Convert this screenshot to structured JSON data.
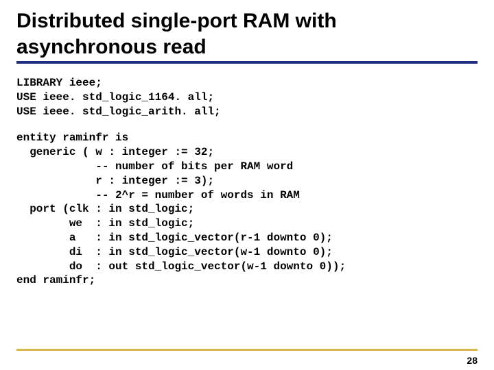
{
  "slide": {
    "title": "Distributed single-port RAM with asynchronous read",
    "page_number": "28"
  },
  "code": {
    "library_section": "LIBRARY ieee;\nUSE ieee. std_logic_1164. all;\nUSE ieee. std_logic_arith. all;",
    "entity_section": "entity raminfr is\n  generic ( w : integer := 32;\n            -- number of bits per RAM word\n            r : integer := 3);\n            -- 2^r = number of words in RAM\n  port (clk : in std_logic;\n        we  : in std_logic;\n        a   : in std_logic_vector(r-1 downto 0);\n        di  : in std_logic_vector(w-1 downto 0);\n        do  : out std_logic_vector(w-1 downto 0));\nend raminfr;"
  }
}
